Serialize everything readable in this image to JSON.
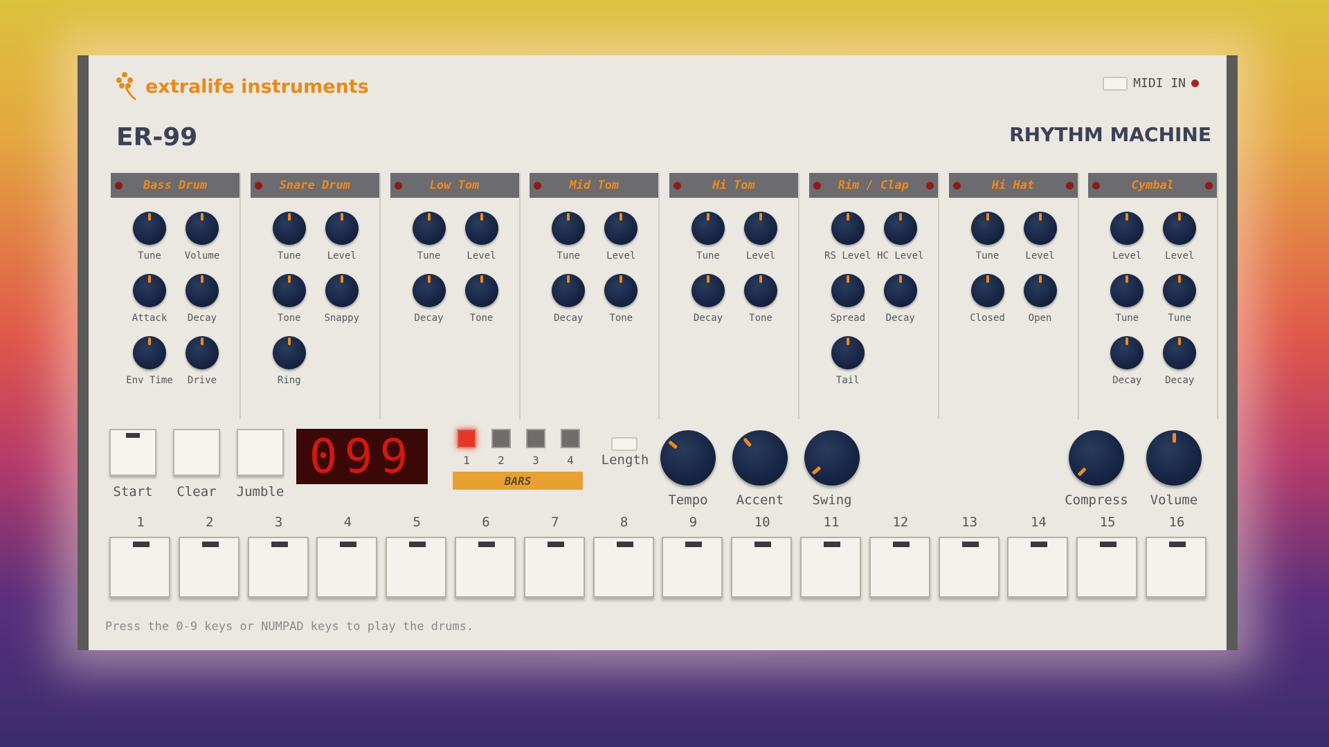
{
  "brand": {
    "logo_text": "extralife instruments",
    "model": "ER-99",
    "subtitle": "RHYTHM MACHINE"
  },
  "midi": {
    "label": "MIDI IN"
  },
  "sections": [
    {
      "name": "Bass Drum",
      "knobs": [
        "Tune",
        "Volume",
        "Attack",
        "Decay",
        "Env Time",
        "Drive"
      ]
    },
    {
      "name": "Snare Drum",
      "knobs": [
        "Tune",
        "Level",
        "Tone",
        "Snappy",
        "Ring"
      ]
    },
    {
      "name": "Low Tom",
      "knobs": [
        "Tune",
        "Level",
        "Decay",
        "Tone"
      ]
    },
    {
      "name": "Mid Tom",
      "knobs": [
        "Tune",
        "Level",
        "Decay",
        "Tone"
      ]
    },
    {
      "name": "Hi Tom",
      "knobs": [
        "Tune",
        "Level",
        "Decay",
        "Tone"
      ]
    },
    {
      "name": "Rim / Clap",
      "knobs": [
        "RS Level",
        "HC Level",
        "Spread",
        "Decay",
        "Tail"
      ]
    },
    {
      "name": "Hi Hat",
      "knobs": [
        "Tune",
        "Level",
        "Closed",
        "Open"
      ]
    },
    {
      "name": "Cymbal",
      "knobs": [
        "Level",
        "Level",
        "Tune",
        "Tune",
        "Decay",
        "Decay"
      ]
    }
  ],
  "transport": {
    "buttons": [
      "Start",
      "Clear",
      "Jumble"
    ],
    "display": "099",
    "bars": {
      "label": "BARS",
      "numbers": [
        "1",
        "2",
        "3",
        "4"
      ],
      "active": 1
    },
    "length_label": "Length",
    "knobs": [
      "Tempo",
      "Accent",
      "Swing",
      "Compress",
      "Volume"
    ]
  },
  "steps": [
    "1",
    "2",
    "3",
    "4",
    "5",
    "6",
    "7",
    "8",
    "9",
    "10",
    "11",
    "12",
    "13",
    "14",
    "15",
    "16"
  ],
  "hint": "Press the 0-9 keys or NUMPAD keys to play the drums.",
  "colors": {
    "accent": "#f08a1e",
    "knob": "#172544",
    "panel": "#ebe8e1",
    "led_red": "#e83626"
  }
}
